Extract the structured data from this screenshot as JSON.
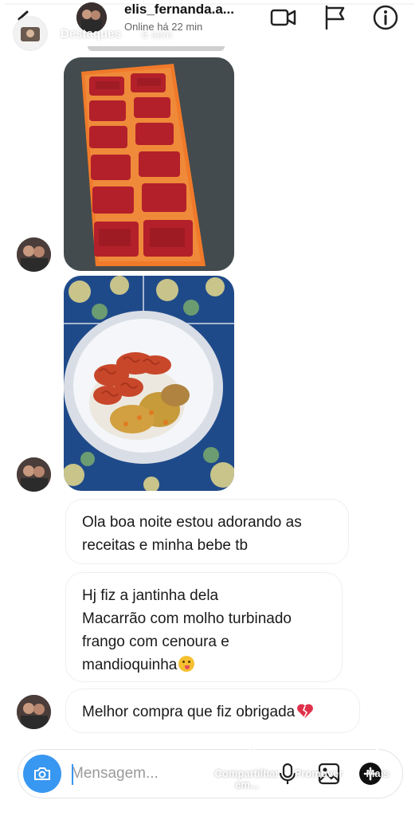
{
  "header": {
    "username": "elis_fernanda.a...",
    "status": "Online há 22 min",
    "icons": [
      "back-arrow-icon",
      "video-call-icon",
      "flag-icon",
      "info-icon"
    ]
  },
  "story_overlay": {
    "title": "Destaques",
    "time": "6 sem"
  },
  "messages": [
    {
      "type": "photo",
      "description_icon": "ice-cube-tray-photo"
    },
    {
      "type": "photo",
      "description_icon": "pasta-plate-photo"
    },
    {
      "type": "text",
      "text": "Ola boa noite estou adorando as receitas e minha bebe tb"
    },
    {
      "type": "text",
      "lines": [
        "Hj fiz a jantinha dela",
        "Macarrão com molho turbinado",
        "frango com cenoura e",
        "mandioquinha"
      ],
      "emoji": "yum-face-emoji"
    },
    {
      "type": "text",
      "text": "Melhor compra que fiz obrigada",
      "emoji": "broken-heart-emoji"
    }
  ],
  "composer": {
    "placeholder": "Mensagem...",
    "icons": [
      "camera-icon",
      "microphone-icon",
      "gallery-icon",
      "add-icon"
    ]
  },
  "story_actions": {
    "share": "Compartilhar em...",
    "promote": "Promover",
    "more": "Mais"
  },
  "colors": {
    "accent": "#3897f0",
    "bubble_border": "#efefef",
    "background": "#ffffff"
  }
}
